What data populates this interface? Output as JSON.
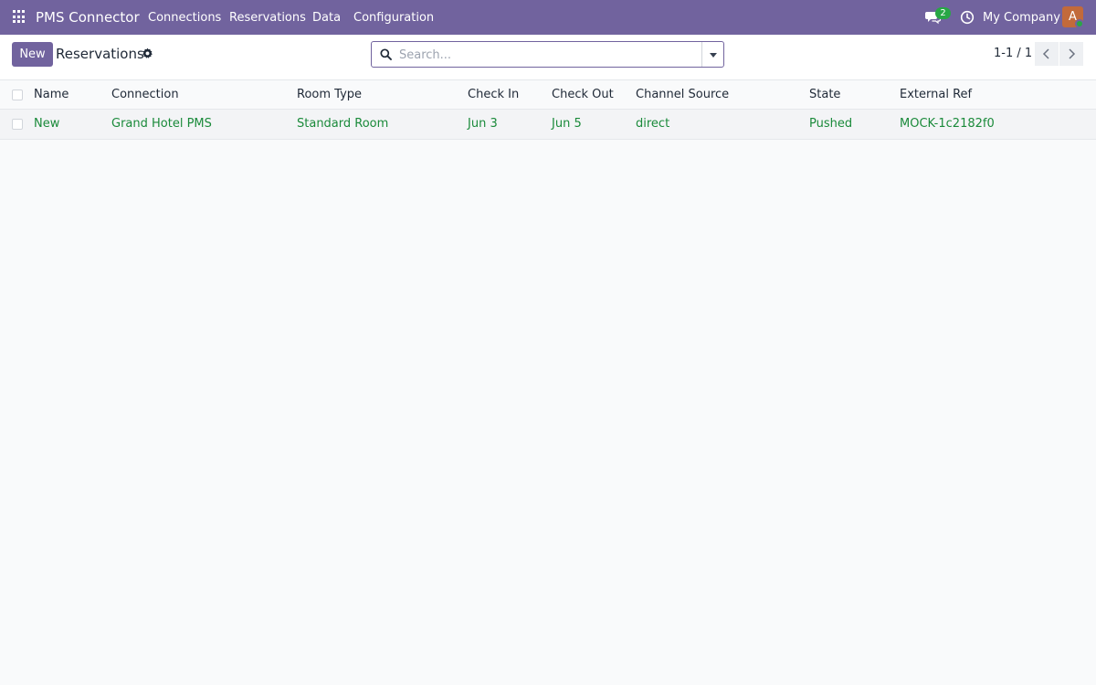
{
  "navbar": {
    "brand": "PMS Connector",
    "menu": [
      "Connections",
      "Reservations",
      "Data",
      "Configuration"
    ],
    "messages_count": "2",
    "company": "My Company",
    "avatar_initial": "A"
  },
  "control_panel": {
    "new_label": "New",
    "title": "Reservations",
    "search_placeholder": "Search...",
    "pager": "1-1 / 1"
  },
  "table": {
    "columns": [
      "Name",
      "Connection",
      "Room Type",
      "Check In",
      "Check Out",
      "Channel Source",
      "State",
      "External Ref"
    ],
    "rows": [
      [
        "New",
        "Grand Hotel PMS",
        "Standard Room",
        "Jun 3",
        "Jun 5",
        "direct",
        "Pushed",
        "MOCK-1c2182f0"
      ]
    ]
  },
  "colors": {
    "brand": "#71639e",
    "link_green": "#1a8a3a",
    "badge_green": "#28a745"
  }
}
